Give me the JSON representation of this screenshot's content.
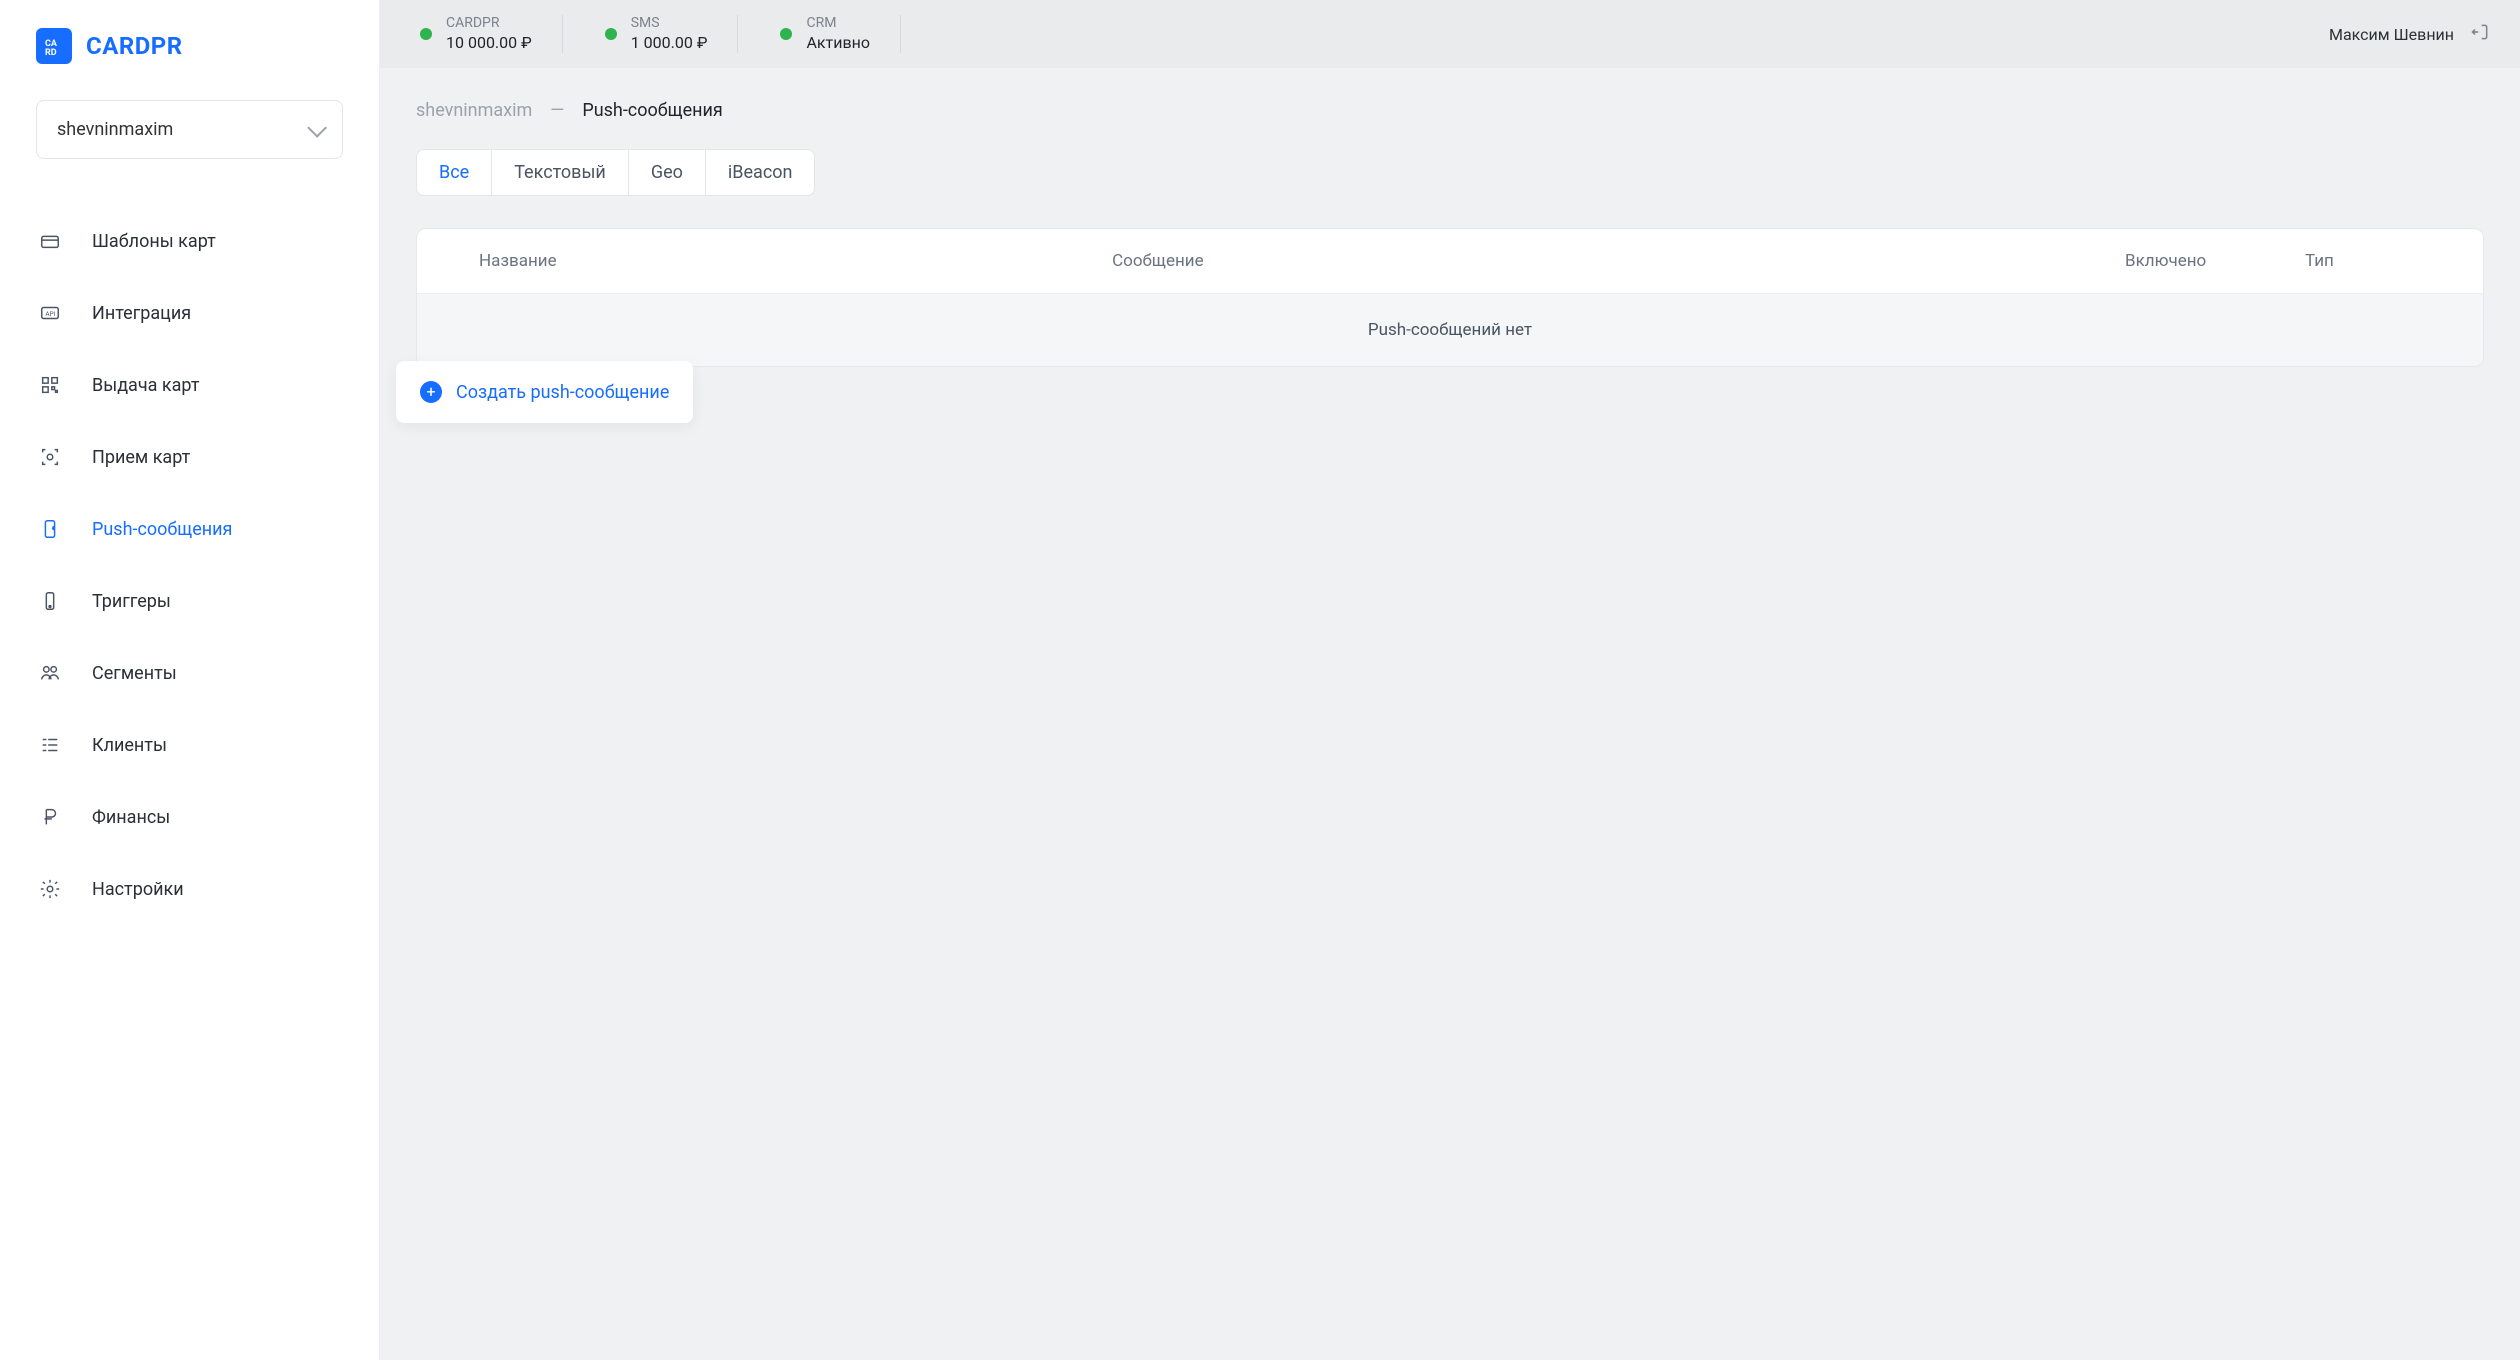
{
  "brand": {
    "name": "CARDPR",
    "mark": "CA"
  },
  "account": {
    "selected": "shevninmaxim"
  },
  "sidebar": {
    "items": [
      {
        "label": "Шаблоны карт",
        "icon": "card"
      },
      {
        "label": "Интеграция",
        "icon": "api"
      },
      {
        "label": "Выдача карт",
        "icon": "qr"
      },
      {
        "label": "Прием карт",
        "icon": "scan"
      },
      {
        "label": "Push-сообщения",
        "icon": "push",
        "active": true
      },
      {
        "label": "Триггеры",
        "icon": "trigger"
      },
      {
        "label": "Сегменты",
        "icon": "segments"
      },
      {
        "label": "Клиенты",
        "icon": "clients"
      },
      {
        "label": "Финансы",
        "icon": "finance"
      },
      {
        "label": "Настройки",
        "icon": "settings"
      }
    ]
  },
  "topbar": {
    "statuses": [
      {
        "label": "CARDPR",
        "value": "10 000.00 ₽"
      },
      {
        "label": "SMS",
        "value": "1 000.00 ₽"
      },
      {
        "label": "CRM",
        "value": "Активно"
      }
    ],
    "user_name": "Максим Шевнин"
  },
  "breadcrumb": {
    "root": "shevninmaxim",
    "sep": "—",
    "current": "Push-сообщения"
  },
  "tabs": [
    {
      "label": "Все",
      "active": true
    },
    {
      "label": "Текстовый"
    },
    {
      "label": "Geo"
    },
    {
      "label": "iBeacon"
    }
  ],
  "table": {
    "columns": {
      "name": "Название",
      "message": "Сообщение",
      "enabled": "Включено",
      "type": "Тип"
    },
    "empty": "Push-сообщений нет"
  },
  "create_button": "Создать push-сообщение"
}
